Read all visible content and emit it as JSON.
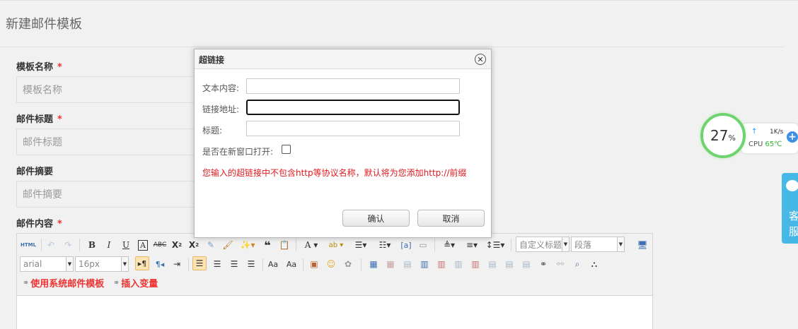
{
  "page": {
    "title": "新建邮件模板"
  },
  "form": {
    "template_name": {
      "label": "模板名称",
      "required": "*",
      "placeholder": "模板名称"
    },
    "mail_subject": {
      "label": "邮件标题",
      "required": "*",
      "placeholder": "邮件标题"
    },
    "mail_summary": {
      "label": "邮件摘要",
      "placeholder": "邮件摘要"
    },
    "mail_content": {
      "label": "邮件内容",
      "required": "*"
    }
  },
  "editor": {
    "html_button": "HTML",
    "font_family": "arial",
    "font_size": "16px",
    "custom_heading": "自定义标题",
    "paragraph": "段落",
    "use_system_template": "使用系统邮件模板",
    "insert_variable": "插入变量",
    "toolbar_row1_icons": [
      "undo-icon",
      "redo-icon",
      "bold-icon",
      "italic-icon",
      "underline-icon",
      "font-border-icon",
      "strikethrough-icon",
      "superscript-icon",
      "subscript-icon",
      "eraser-icon",
      "format-brush-icon",
      "auto-typeset-icon",
      "blockquote-icon",
      "paste-text-icon",
      "font-color-icon",
      "background-color-icon",
      "ordered-list-icon",
      "unordered-list-icon",
      "select-all-icon",
      "clear-doc-icon",
      "row-spacing-top-icon",
      "row-spacing-bottom-icon",
      "line-height-icon",
      "preview-icon"
    ],
    "toolbar_row2_icons": [
      "ltr-icon",
      "rtl-icon",
      "indent-icon",
      "align-left-icon",
      "align-center-icon",
      "align-right-icon",
      "justify-icon",
      "to-upper-icon",
      "to-lower-icon",
      "insert-image-icon",
      "emotion-icon",
      "scrawl-icon",
      "insert-table-icon",
      "delete-table-icon",
      "insert-paragraph-before-table-icon",
      "insert-row-icon",
      "delete-row-icon",
      "insert-col-icon",
      "delete-col-icon",
      "merge-cells-icon",
      "merge-right-icon",
      "merge-down-icon",
      "split-cells-icon",
      "link-icon",
      "unlink-icon",
      "search-replace-icon",
      "binoculars-icon"
    ]
  },
  "dialog": {
    "title": "超链接",
    "text_label": "文本内容:",
    "url_label": "链接地址:",
    "tip_label": "标题:",
    "new_window_label": "是否在新窗口打开:",
    "warning": "您输入的超链接中不包含http等协议名称，默认将为您添加http://前缀",
    "ok": "确认",
    "cancel": "取消"
  },
  "monitor": {
    "cpu_percent": "27",
    "percent_sign": "%",
    "net_speed": "1K/s",
    "cpu_label": "CPU",
    "cpu_temp": "65℃",
    "colors": {
      "ring": "#6fd36f",
      "temp": "#2ab82a",
      "arrow": "#1e90ff"
    }
  },
  "service": {
    "chars": [
      "客",
      "服"
    ],
    "color": "#46b8e8"
  }
}
